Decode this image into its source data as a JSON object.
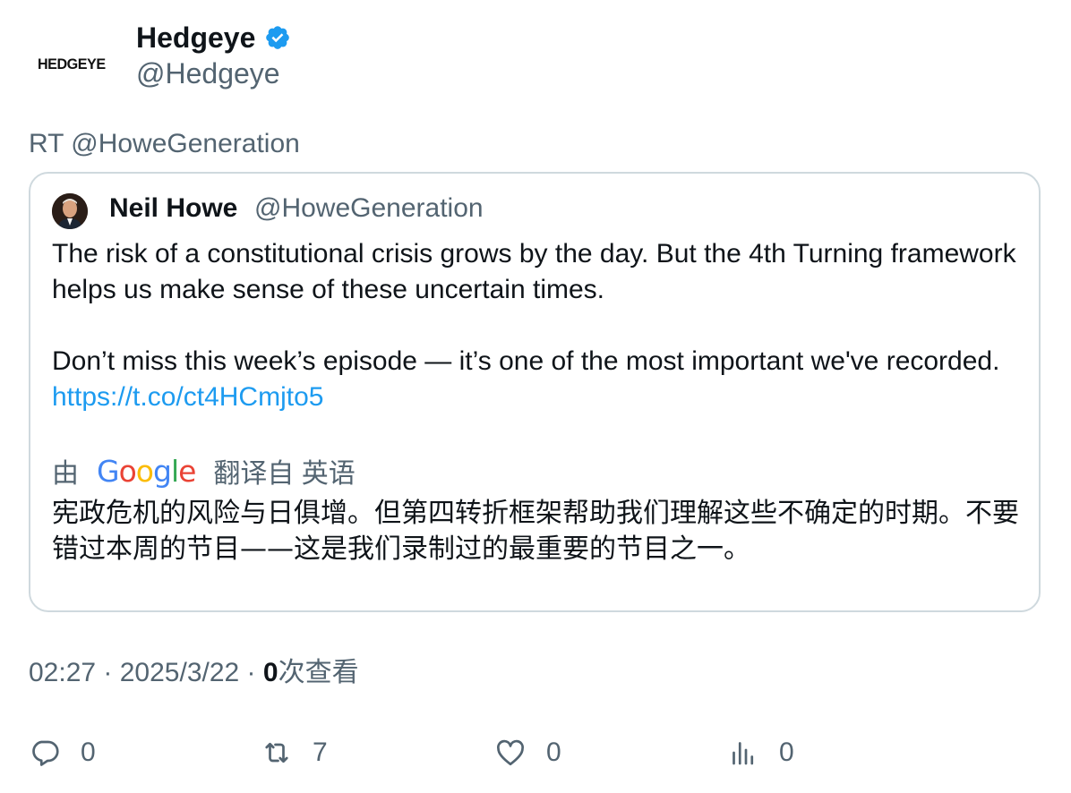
{
  "tweet": {
    "author": {
      "logo_text": "HEDGEYE",
      "name": "Hedgeye",
      "handle": "@Hedgeye"
    },
    "retweet_line": "RT @HoweGeneration",
    "quoted": {
      "name": "Neil Howe",
      "handle": "@HoweGeneration",
      "paragraph1": "The risk of a constitutional crisis grows by the day. But the 4th Turning framework helps us make sense of these uncertain times.",
      "paragraph2_text": "Don’t miss this week’s episode — it’s one of the most important we've recorded. ",
      "paragraph2_link": "https://t.co/ct4HCmjto5",
      "translate_prefix": "由",
      "translate_suffix": "翻译自 英语",
      "translation": "宪政危机的风险与日俱增。但第四转折框架帮助我们理解这些不确定的时期。不要错过本周的节目——这是我们录制过的最重要的节目之一。"
    },
    "meta": {
      "time": "02:27",
      "separator1": " · ",
      "date": "2025/3/22",
      "separator2": " · ",
      "views_count": "0",
      "views_label": "次查看"
    },
    "actions": {
      "replies": "0",
      "retweets": "7",
      "likes": "0",
      "views": "0"
    },
    "colors": {
      "link": "#1d9bf0",
      "verified": "#1d9bf0",
      "secondary_text": "#536471",
      "border": "#cfd9de"
    }
  }
}
